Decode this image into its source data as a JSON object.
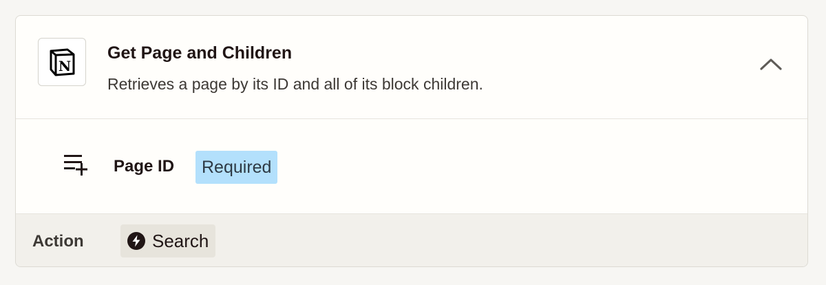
{
  "step": {
    "app_icon": "notion-logo-icon",
    "title": "Get Page and Children",
    "description": "Retrieves a page by its ID and all of its block children.",
    "collapse_icon": "chevron-up-icon"
  },
  "field": {
    "icon": "playlist-add-icon",
    "label": "Page ID",
    "badge": "Required",
    "badge_color": "#b3e0fc"
  },
  "footer": {
    "label": "Action",
    "chip_icon": "bolt-circle-icon",
    "chip_label": "Search"
  }
}
